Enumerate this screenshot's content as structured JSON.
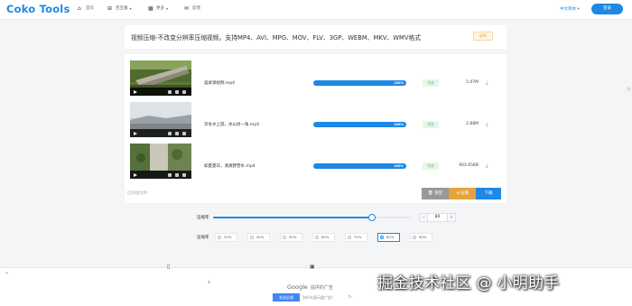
{
  "header": {
    "logo": "Coko Tools",
    "nav": [
      {
        "icon": "home-icon",
        "label": "首页"
      },
      {
        "icon": "toolbox-icon",
        "label": "百宝箱"
      },
      {
        "icon": "grid-icon",
        "label": "更多"
      },
      {
        "icon": "feedback-icon",
        "label": "反馈"
      }
    ],
    "language": "中文简体 ▾",
    "login": "登录"
  },
  "intro": {
    "text": "视频压缩-不改变分辨率压缩视频。支持MP4、AVI、MPG、MOV、FLV、3GP、WEBM、MKV、WMV格式",
    "badge": "说明"
  },
  "files": [
    {
      "name": "竖屏源视频.mp4",
      "progress_percent": 100,
      "progress_label": "100%",
      "status": "完成",
      "size": "5.07M"
    },
    {
      "name": "深冬水上游，冰山另一角.mp4",
      "progress_percent": 100,
      "progress_label": "100%",
      "status": "完成",
      "size": "2.88M"
    },
    {
      "name": "如夏夏日，清爽野营水.mp4",
      "progress_percent": 100,
      "progress_label": "100%",
      "status": "完成",
      "size": "903.65KB"
    }
  ],
  "list_footer": {
    "label": "已添加文件",
    "clear": "清空",
    "compress": "压缩",
    "download": "下载"
  },
  "compress_ratio": {
    "label": "压缩率",
    "value": "80",
    "level_fraction": 0.8
  },
  "presets": {
    "label": "压缩率",
    "options": [
      "30%",
      "40%",
      "50%",
      "60%",
      "70%",
      "80%",
      "90%"
    ],
    "selected_index": 5
  },
  "ad": {
    "small_label": "▲",
    "google": "Google",
    "google_suffix": "提供的广告",
    "feedback_button": "发送反馈",
    "why": "为什么显示此广告？"
  },
  "watermark": "掘金技术社区 @ 小明助手",
  "colors": {
    "accent": "#1e88e5",
    "warning": "#e6a23c",
    "success_bg": "#e8f5e9",
    "success_text": "#6abf69"
  }
}
